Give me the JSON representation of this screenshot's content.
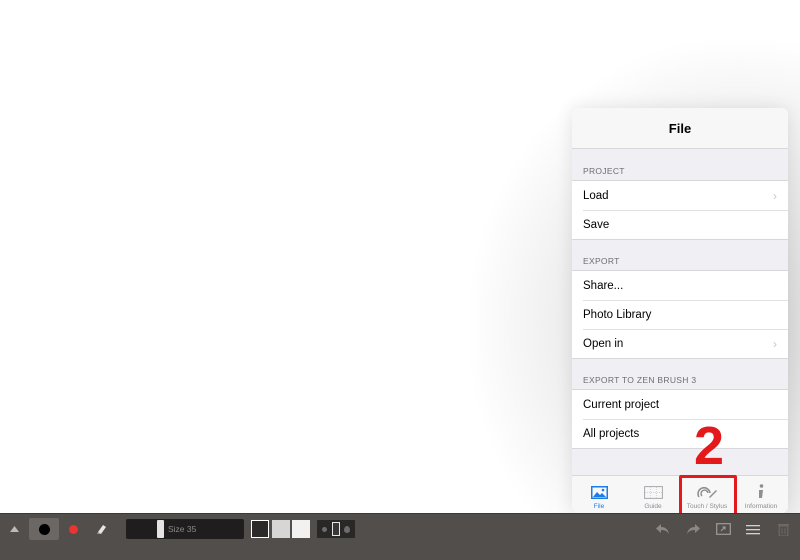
{
  "popover": {
    "title": "File",
    "sections": [
      {
        "header": "PROJECT",
        "rows": [
          {
            "label": "Load",
            "chevron": true
          },
          {
            "label": "Save",
            "chevron": false
          }
        ]
      },
      {
        "header": "EXPORT",
        "rows": [
          {
            "label": "Share...",
            "chevron": false
          },
          {
            "label": "Photo Library",
            "chevron": false
          },
          {
            "label": "Open in",
            "chevron": true
          }
        ]
      },
      {
        "header": "EXPORT TO ZEN BRUSH 3",
        "rows": [
          {
            "label": "Current project",
            "chevron": false
          },
          {
            "label": "All projects",
            "chevron": false
          }
        ]
      }
    ],
    "tabs": [
      {
        "label": "File",
        "icon": "photo-icon",
        "active": true
      },
      {
        "label": "Guide",
        "icon": "grid-icon",
        "active": false
      },
      {
        "label": "Touch / Stylus",
        "icon": "stylus-icon",
        "active": false
      },
      {
        "label": "Information",
        "icon": "info-icon",
        "active": false
      }
    ]
  },
  "annotation": {
    "step_number": "2",
    "color": "#e3191b"
  },
  "toolbar": {
    "size_label": "Size 35",
    "active_color": "#e8352d",
    "ink_color": "#000000"
  },
  "theme": {
    "accent": "#1a7ce8",
    "toolbar_bg": "#514e4c"
  }
}
